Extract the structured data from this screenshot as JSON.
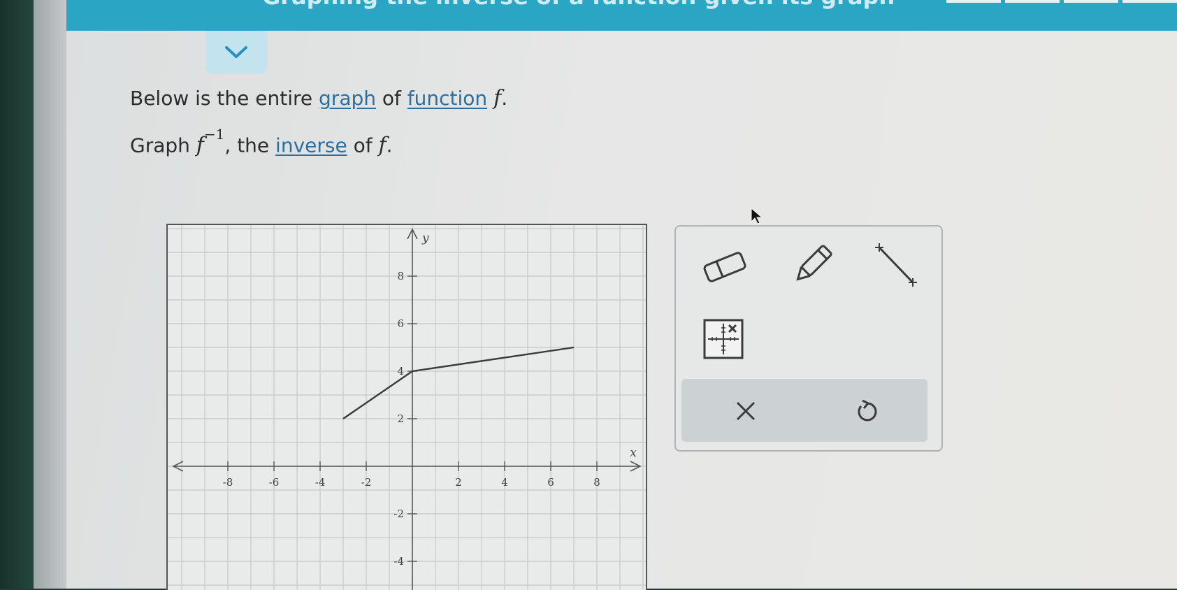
{
  "header": {
    "title": "Graphing the inverse of a function given its graph"
  },
  "prompt": {
    "line1": {
      "before": "Below is the entire ",
      "link1": "graph",
      "middle": " of ",
      "link2": "function",
      "var": "f",
      "after": "."
    },
    "line2": {
      "before": "Graph ",
      "var": "f",
      "exponent": "−1",
      "middle": ", the ",
      "link": "inverse",
      "of": " of ",
      "var2": "f",
      "after": "."
    }
  },
  "graph": {
    "x_axis_label": "x",
    "y_axis_label": "y",
    "x_ticks": [
      "-8",
      "-6",
      "-4",
      "-2",
      "2",
      "4",
      "6",
      "8"
    ],
    "y_ticks": [
      "8",
      "6",
      "4",
      "2",
      "-2",
      "-4"
    ],
    "x_range": [
      -10,
      10
    ],
    "y_range": [
      -6,
      10
    ],
    "function_points": [
      [
        -3,
        2
      ],
      [
        0,
        4
      ],
      [
        7,
        5
      ]
    ],
    "line_color": "#3a3a3a"
  },
  "tools": {
    "eraser": "eraser-icon",
    "pencil": "pencil-icon",
    "line_segment": "line-segment-icon",
    "no_solution": "no-solution-grid-icon",
    "clear": "close-icon",
    "undo": "undo-icon",
    "accent": "#2c6f9e"
  }
}
